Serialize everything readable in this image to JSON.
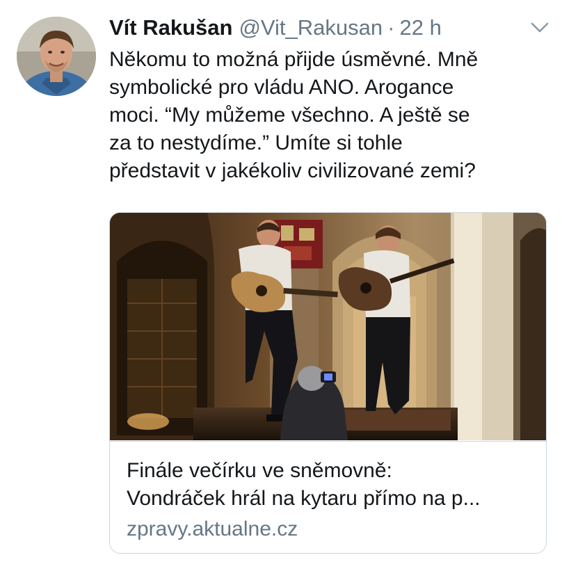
{
  "tweet": {
    "author": {
      "display_name": "Vít Rakušan",
      "handle": "@Vit_Rakusan",
      "avatar_icon": "profile-photo"
    },
    "separator": "·",
    "time": "22 h",
    "menu_icon": "chevron-down-icon",
    "text_lines": [
      "Někomu to možná přijde úsměvné. Mně",
      "symbolické pro vládu ANO. Arogance",
      "moci. “My můžeme všechno. A ještě se",
      "za to nestydíme.” Umíte si tohle",
      "představit v jakékoliv civilizované zemi?"
    ]
  },
  "card": {
    "image_icon": "photo-guitarists-on-stage",
    "title_lines": [
      "Finále večírku ve sněmovně:",
      "Vondráček hrál na kytaru přímo na p..."
    ],
    "domain": "zpravy.aktualne.cz"
  },
  "colors": {
    "text_primary": "#14171a",
    "text_secondary": "#657786",
    "border": "#ccd6dd",
    "background": "#ffffff"
  }
}
